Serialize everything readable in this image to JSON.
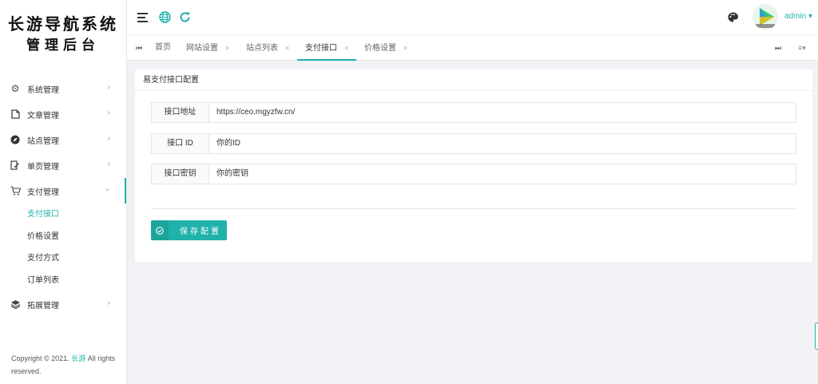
{
  "logo": {
    "line1": "长游导航系统",
    "line2": "管理后台"
  },
  "sidebar": {
    "items": [
      {
        "label": "系统管理",
        "icon": "gear-icon"
      },
      {
        "label": "文章管理",
        "icon": "file-icon"
      },
      {
        "label": "站点管理",
        "icon": "compass-icon"
      },
      {
        "label": "单页管理",
        "icon": "edit-page-icon"
      },
      {
        "label": "支付管理",
        "icon": "cart-icon"
      }
    ],
    "pay_sub": [
      "支付接口",
      "价格设置",
      "支付方式",
      "订单列表"
    ],
    "extend": {
      "label": "拓展管理",
      "icon": "layers-icon"
    },
    "arrow_right": "›",
    "arrow_down": "›"
  },
  "copyright": {
    "prefix": "Copyright © 2021.",
    "brand": "长游",
    "suffix": "All rights reserved."
  },
  "header": {
    "user": "admin ▾"
  },
  "tabs": [
    {
      "label": "首页",
      "closable": false
    },
    {
      "label": "网站设置",
      "closable": true
    },
    {
      "label": "站点列表",
      "closable": true
    },
    {
      "label": "支付接口",
      "closable": true,
      "active": true
    },
    {
      "label": "价格设置",
      "closable": true
    }
  ],
  "tab_close": "×",
  "card": {
    "title": "易支付接口配置",
    "fields": [
      {
        "label": "接口地址",
        "value": "https://ceo.mgyzfw.cn/"
      },
      {
        "label": "接口 ID",
        "value": "你的ID"
      },
      {
        "label": "接口密钥",
        "value": "你的密钥"
      }
    ],
    "save_label": "保存配置"
  },
  "colors": {
    "accent": "#20b2aa"
  }
}
